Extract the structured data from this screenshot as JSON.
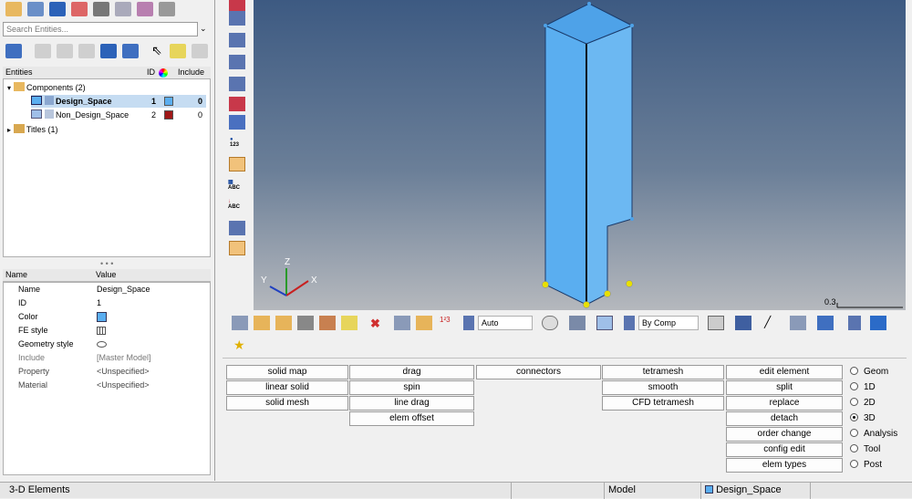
{
  "colors": {
    "accent": "#5aaef0",
    "part_blue": "#5aaef0",
    "part_red": "#a01818",
    "selection": "#c5dcf2"
  },
  "search": {
    "placeholder": "Search Entities..."
  },
  "entities_header": {
    "entities": "Entities",
    "id": "ID",
    "include": "Include"
  },
  "tree": {
    "components": "Components (2)",
    "items": [
      {
        "name": "Design_Space",
        "id": "1",
        "include": "0",
        "color": "#5aaef0"
      },
      {
        "name": "Non_Design_Space",
        "id": "2",
        "include": "0",
        "color": "#a01818"
      }
    ],
    "titles": "Titles (1)"
  },
  "properties": {
    "header_name": "Name",
    "header_value": "Value",
    "rows": [
      {
        "name": "Name",
        "value": "Design_Space"
      },
      {
        "name": "ID",
        "value": "1"
      },
      {
        "name": "Color",
        "value": ""
      },
      {
        "name": "FE style",
        "value": ""
      },
      {
        "name": "Geometry style",
        "value": ""
      },
      {
        "name": "Include",
        "value": "[Master Model]"
      },
      {
        "name": "Property",
        "value": "<Unspecified>"
      },
      {
        "name": "Material",
        "value": "<Unspecified>"
      }
    ]
  },
  "viewport": {
    "scale_label": "0.3",
    "axis_x": "X",
    "axis_y": "Y",
    "axis_z": "Z"
  },
  "sidebar": {
    "label_123": "123",
    "label_abc1": "ABC",
    "label_abc2": "ABC"
  },
  "toolbar": {
    "auto_select": "Auto",
    "color_mode": "By Comp"
  },
  "panel": {
    "col1": [
      "solid map",
      "linear solid",
      "solid mesh"
    ],
    "col2": [
      "drag",
      "spin",
      "line drag",
      "elem offset"
    ],
    "col3": [
      "connectors"
    ],
    "col4": [
      "tetramesh",
      "smooth",
      "CFD tetramesh"
    ],
    "col5": [
      "edit element",
      "split",
      "replace",
      "detach",
      "order change",
      "config edit",
      "elem types"
    ],
    "pages": [
      "Geom",
      "1D",
      "2D",
      "3D",
      "Analysis",
      "Tool",
      "Post"
    ],
    "active_page": "3D"
  },
  "status": {
    "panel_name": "3-D Elements",
    "model": "Model",
    "component": "Design_Space"
  }
}
